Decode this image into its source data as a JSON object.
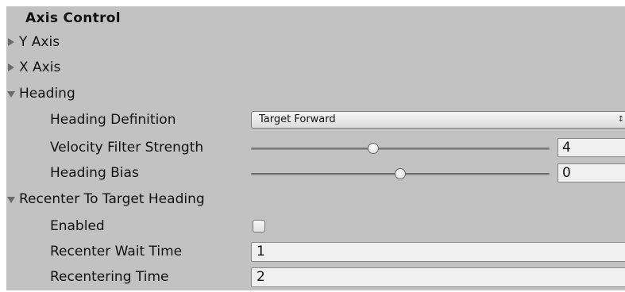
{
  "header": {
    "title": "Axis Control"
  },
  "sections": {
    "y_axis": {
      "label": "Y Axis",
      "expanded": false
    },
    "x_axis": {
      "label": "X Axis",
      "expanded": false
    },
    "heading": {
      "label": "Heading",
      "expanded": true
    },
    "recenter": {
      "label": "Recenter To Target Heading",
      "expanded": true
    }
  },
  "heading": {
    "definition": {
      "label": "Heading Definition",
      "value": "Target Forward"
    },
    "velocity_filter": {
      "label": "Velocity Filter Strength",
      "value": "4",
      "slider_fraction": 0.41
    },
    "bias": {
      "label": "Heading Bias",
      "value": "0",
      "slider_fraction": 0.5
    }
  },
  "recenter": {
    "enabled": {
      "label": "Enabled",
      "checked": false
    },
    "wait_time": {
      "label": "Recenter Wait Time",
      "value": "1"
    },
    "recentering_time": {
      "label": "Recentering Time",
      "value": "2"
    }
  },
  "icons": {
    "collapsed": "triangle-right-icon",
    "expanded": "triangle-down-icon",
    "dropdown": "up-down-caret-icon"
  },
  "colors": {
    "panel_bg": "#c2c2c2",
    "field_bg": "#f0f0f0"
  }
}
